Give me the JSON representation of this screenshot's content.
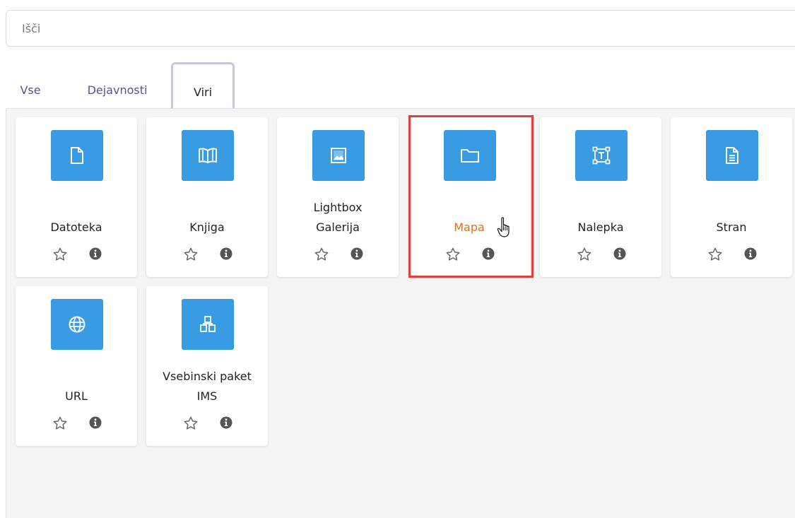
{
  "search": {
    "placeholder": "Išči",
    "value": ""
  },
  "tabs": [
    {
      "label": "Vse"
    },
    {
      "label": "Dejavnosti"
    },
    {
      "label": "Viri",
      "active": true
    }
  ],
  "colors": {
    "icon_bg": "#399be2",
    "tab_text": "#5a4f96",
    "selected_text": "#e1701d",
    "highlight_border": "#e04040",
    "panel_bg": "#f5f5f5"
  },
  "resources": [
    {
      "name": "Datoteka",
      "icon": "file-icon"
    },
    {
      "name": "Knjiga",
      "icon": "book-icon"
    },
    {
      "name_lines": [
        "Lightbox",
        "Galerija"
      ],
      "icon": "image-gallery-icon"
    },
    {
      "name": "Mapa",
      "icon": "folder-icon",
      "selected": true
    },
    {
      "name": "Nalepka",
      "icon": "text-label-icon"
    },
    {
      "name": "Stran",
      "icon": "page-icon"
    },
    {
      "name": "URL",
      "icon": "globe-icon"
    },
    {
      "name_lines": [
        "Vsebinski paket",
        "IMS"
      ],
      "icon": "ims-package-icon"
    }
  ]
}
